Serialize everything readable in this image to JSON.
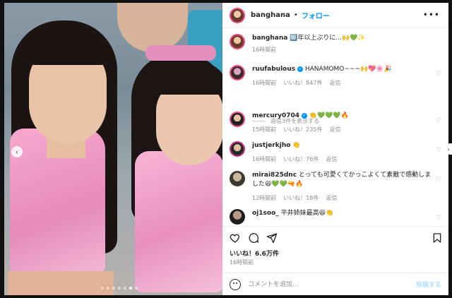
{
  "header": {
    "username": "banghana",
    "separator": "•",
    "follow_label": "フォロー",
    "more_label": "•••"
  },
  "caption": {
    "username": "banghana",
    "text": "🔟年以上ぶりに...🙌💚✨",
    "time": "16時間前"
  },
  "comments": [
    {
      "username": "ruufabulous",
      "verified": true,
      "text": "HANAMOMO~~~🙌💖🌸🎉",
      "time": "16時間前",
      "likes": "いいね！847件",
      "reply": "返信"
    },
    {
      "username": "mercury0704",
      "verified": true,
      "text": "👏💚💚💚🔥",
      "time": "15時間前",
      "likes": "いいね！235件",
      "reply": "返信"
    },
    {
      "username": "justjerkjho",
      "verified": false,
      "text": "👏",
      "time": "16時間前",
      "likes": "いいね！76件",
      "reply": "返信"
    },
    {
      "username": "mirai825dnc",
      "verified": false,
      "text": "とっても可愛くてかっこよくて素敵で感動しました😆💚💚🔫🔥",
      "time": "12時間前",
      "likes": "いいね！18件",
      "reply": "返信"
    },
    {
      "username": "oj1soo_",
      "verified": false,
      "text": "平井姉妹最高😆👏",
      "time": "",
      "likes": "",
      "reply": ""
    }
  ],
  "view_replies": "返信3件を表示する",
  "likes_count": "いいね！6.6万件",
  "post_time": "16時間前",
  "comment_box": {
    "placeholder": "コメントを追加...",
    "post_label": "投稿する"
  },
  "carousel": {
    "total": 7,
    "active": 6
  },
  "colors": {
    "accent": "#0095f6",
    "muted": "#8e8e8e",
    "post_disabled": "#b2dffc"
  }
}
